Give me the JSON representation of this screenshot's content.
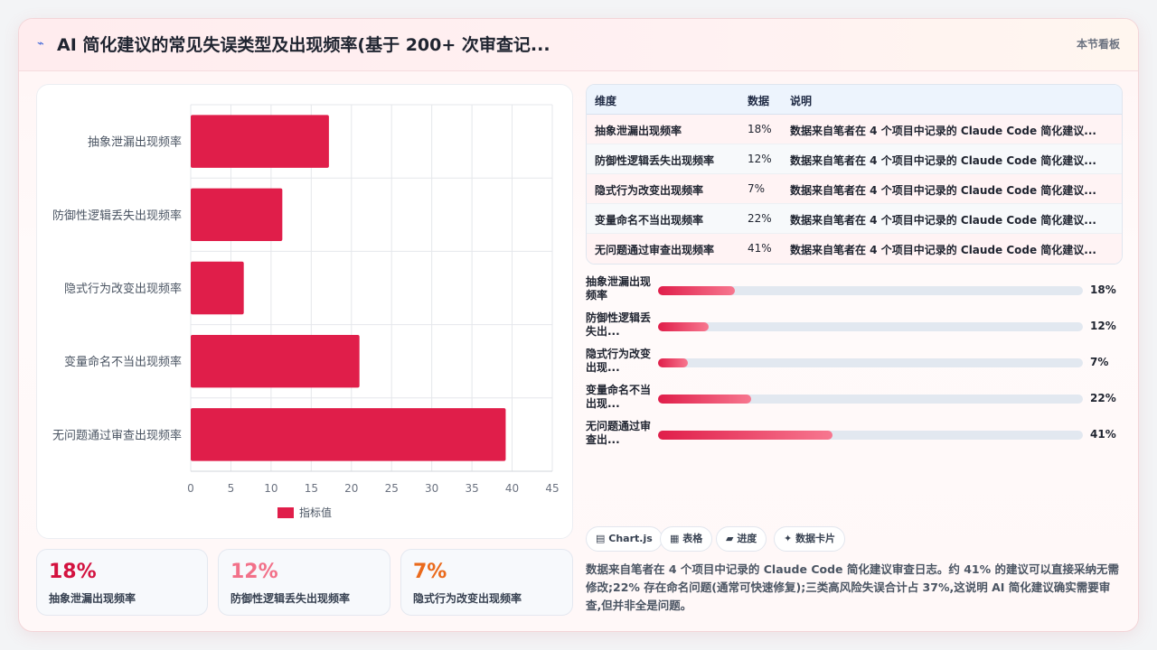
{
  "header": {
    "icon": "sparkle-icon",
    "title": "AI 简化建议的常见失误类型及出现频率(基于 200+ 次审查记...",
    "nav_label": "本节看板"
  },
  "chart_data": {
    "type": "bar",
    "orientation": "horizontal",
    "categories": [
      "抽象泄漏出现频率",
      "防御性逻辑丢失出现频率",
      "隐式行为改变出现频率",
      "变量命名不当出现频率",
      "无问题通过审查出现频率"
    ],
    "series": [
      {
        "name": "指标值",
        "values": [
          17.2,
          11.4,
          6.6,
          21,
          39.2
        ],
        "color": "#e01e4a"
      }
    ],
    "xlim": [
      0,
      45
    ],
    "xticks": [
      "0",
      "5",
      "10",
      "15",
      "20",
      "25",
      "30",
      "35",
      "40",
      "45"
    ],
    "grid": true,
    "legend": "bottom"
  },
  "stats": [
    {
      "value": "18%",
      "label": "抽象泄漏出现频率",
      "color": "#d3123f"
    },
    {
      "value": "12%",
      "label": "防御性逻辑丢失出现频率",
      "color": "#f27189"
    },
    {
      "value": "7%",
      "label": "隐式行为改变出现频率",
      "color": "#ea6a1c"
    }
  ],
  "table": {
    "headers": [
      "维度",
      "数据",
      "说明"
    ],
    "rows": [
      {
        "dim": "抽象泄漏出现频率",
        "val": "18%",
        "desc": "数据来自笔者在 4 个项目中记录的 Claude Code 简化建议..."
      },
      {
        "dim": "防御性逻辑丢失出现频率",
        "val": "12%",
        "desc": "数据来自笔者在 4 个项目中记录的 Claude Code 简化建议..."
      },
      {
        "dim": "隐式行为改变出现频率",
        "val": "7%",
        "desc": "数据来自笔者在 4 个项目中记录的 Claude Code 简化建议..."
      },
      {
        "dim": "变量命名不当出现频率",
        "val": "22%",
        "desc": "数据来自笔者在 4 个项目中记录的 Claude Code 简化建议..."
      },
      {
        "dim": "无问题通过审查出现频率",
        "val": "41%",
        "desc": "数据来自笔者在 4 个项目中记录的 Claude Code 简化建议..."
      }
    ]
  },
  "progress": [
    {
      "label": "抽象泄漏出现频率",
      "display": "18%",
      "pct": 18
    },
    {
      "label": "防御性逻辑丢失出...",
      "display": "12%",
      "pct": 12
    },
    {
      "label": "隐式行为改变出现...",
      "display": "7%",
      "pct": 7
    },
    {
      "label": "变量命名不当出现...",
      "display": "22%",
      "pct": 22
    },
    {
      "label": "无问题通过审查出...",
      "display": "41%",
      "pct": 41
    }
  ],
  "chips": [
    {
      "icon": "chart-icon",
      "glyph": "▤",
      "label": "Chart.js"
    },
    {
      "icon": "table-icon",
      "glyph": "▦",
      "label": "表格"
    },
    {
      "icon": "progress-icon",
      "glyph": "▰",
      "label": "进度"
    },
    {
      "icon": "card-icon",
      "glyph": "✦",
      "label": "数据卡片"
    }
  ],
  "summary": "数据来自笔者在 4 个项目中记录的 Claude Code 简化建议审查日志。约 41% 的建议可以直接采纳无需修改;22% 存在命名问题(通常可快速修复);三类高风险失误合计占 37%,这说明 AI 简化建议确实需要审查,但并非全是问题。"
}
